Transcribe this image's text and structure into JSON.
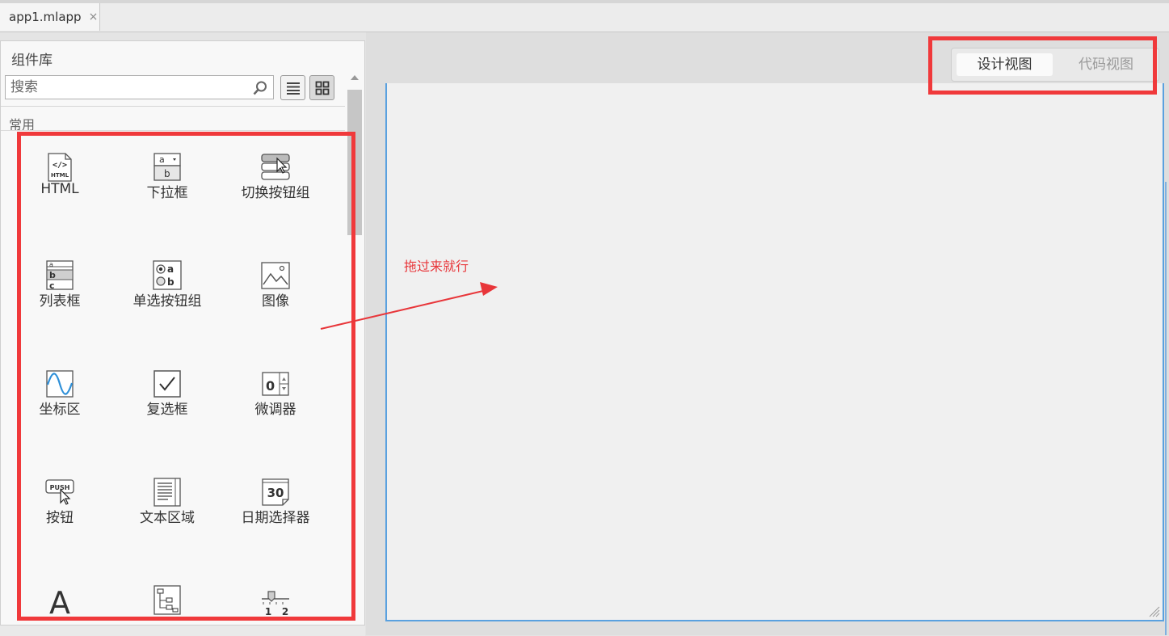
{
  "tabs": {
    "document_tab": "app1.mlapp",
    "close_glyph": "×"
  },
  "library": {
    "title": "组件库",
    "search_placeholder": "搜索",
    "category": "常用",
    "components": [
      {
        "label": "HTML",
        "icon": "html-icon"
      },
      {
        "label": "下拉框",
        "icon": "dropdown-icon"
      },
      {
        "label": "切换按钮组",
        "icon": "toggle-button-group-icon"
      },
      {
        "label": "列表框",
        "icon": "listbox-icon"
      },
      {
        "label": "单选按钮组",
        "icon": "radio-button-group-icon"
      },
      {
        "label": "图像",
        "icon": "image-icon"
      },
      {
        "label": "坐标区",
        "icon": "axes-icon"
      },
      {
        "label": "复选框",
        "icon": "checkbox-icon"
      },
      {
        "label": "微调器",
        "icon": "spinner-icon"
      },
      {
        "label": "按钮",
        "icon": "push-button-icon"
      },
      {
        "label": "文本区域",
        "icon": "text-area-icon"
      },
      {
        "label": "日期选择器",
        "icon": "date-picker-icon"
      },
      {
        "label": "",
        "icon": "label-icon"
      },
      {
        "label": "",
        "icon": "tree-icon"
      },
      {
        "label": "",
        "icon": "slider-icon"
      }
    ]
  },
  "view_toggle": {
    "design": "设计视图",
    "code": "代码视图"
  },
  "annotation": {
    "text": "拖过来就行",
    "color": "#e8363a"
  },
  "colors": {
    "highlight_red": "#f0393b",
    "canvas_border": "#5aa1df"
  }
}
